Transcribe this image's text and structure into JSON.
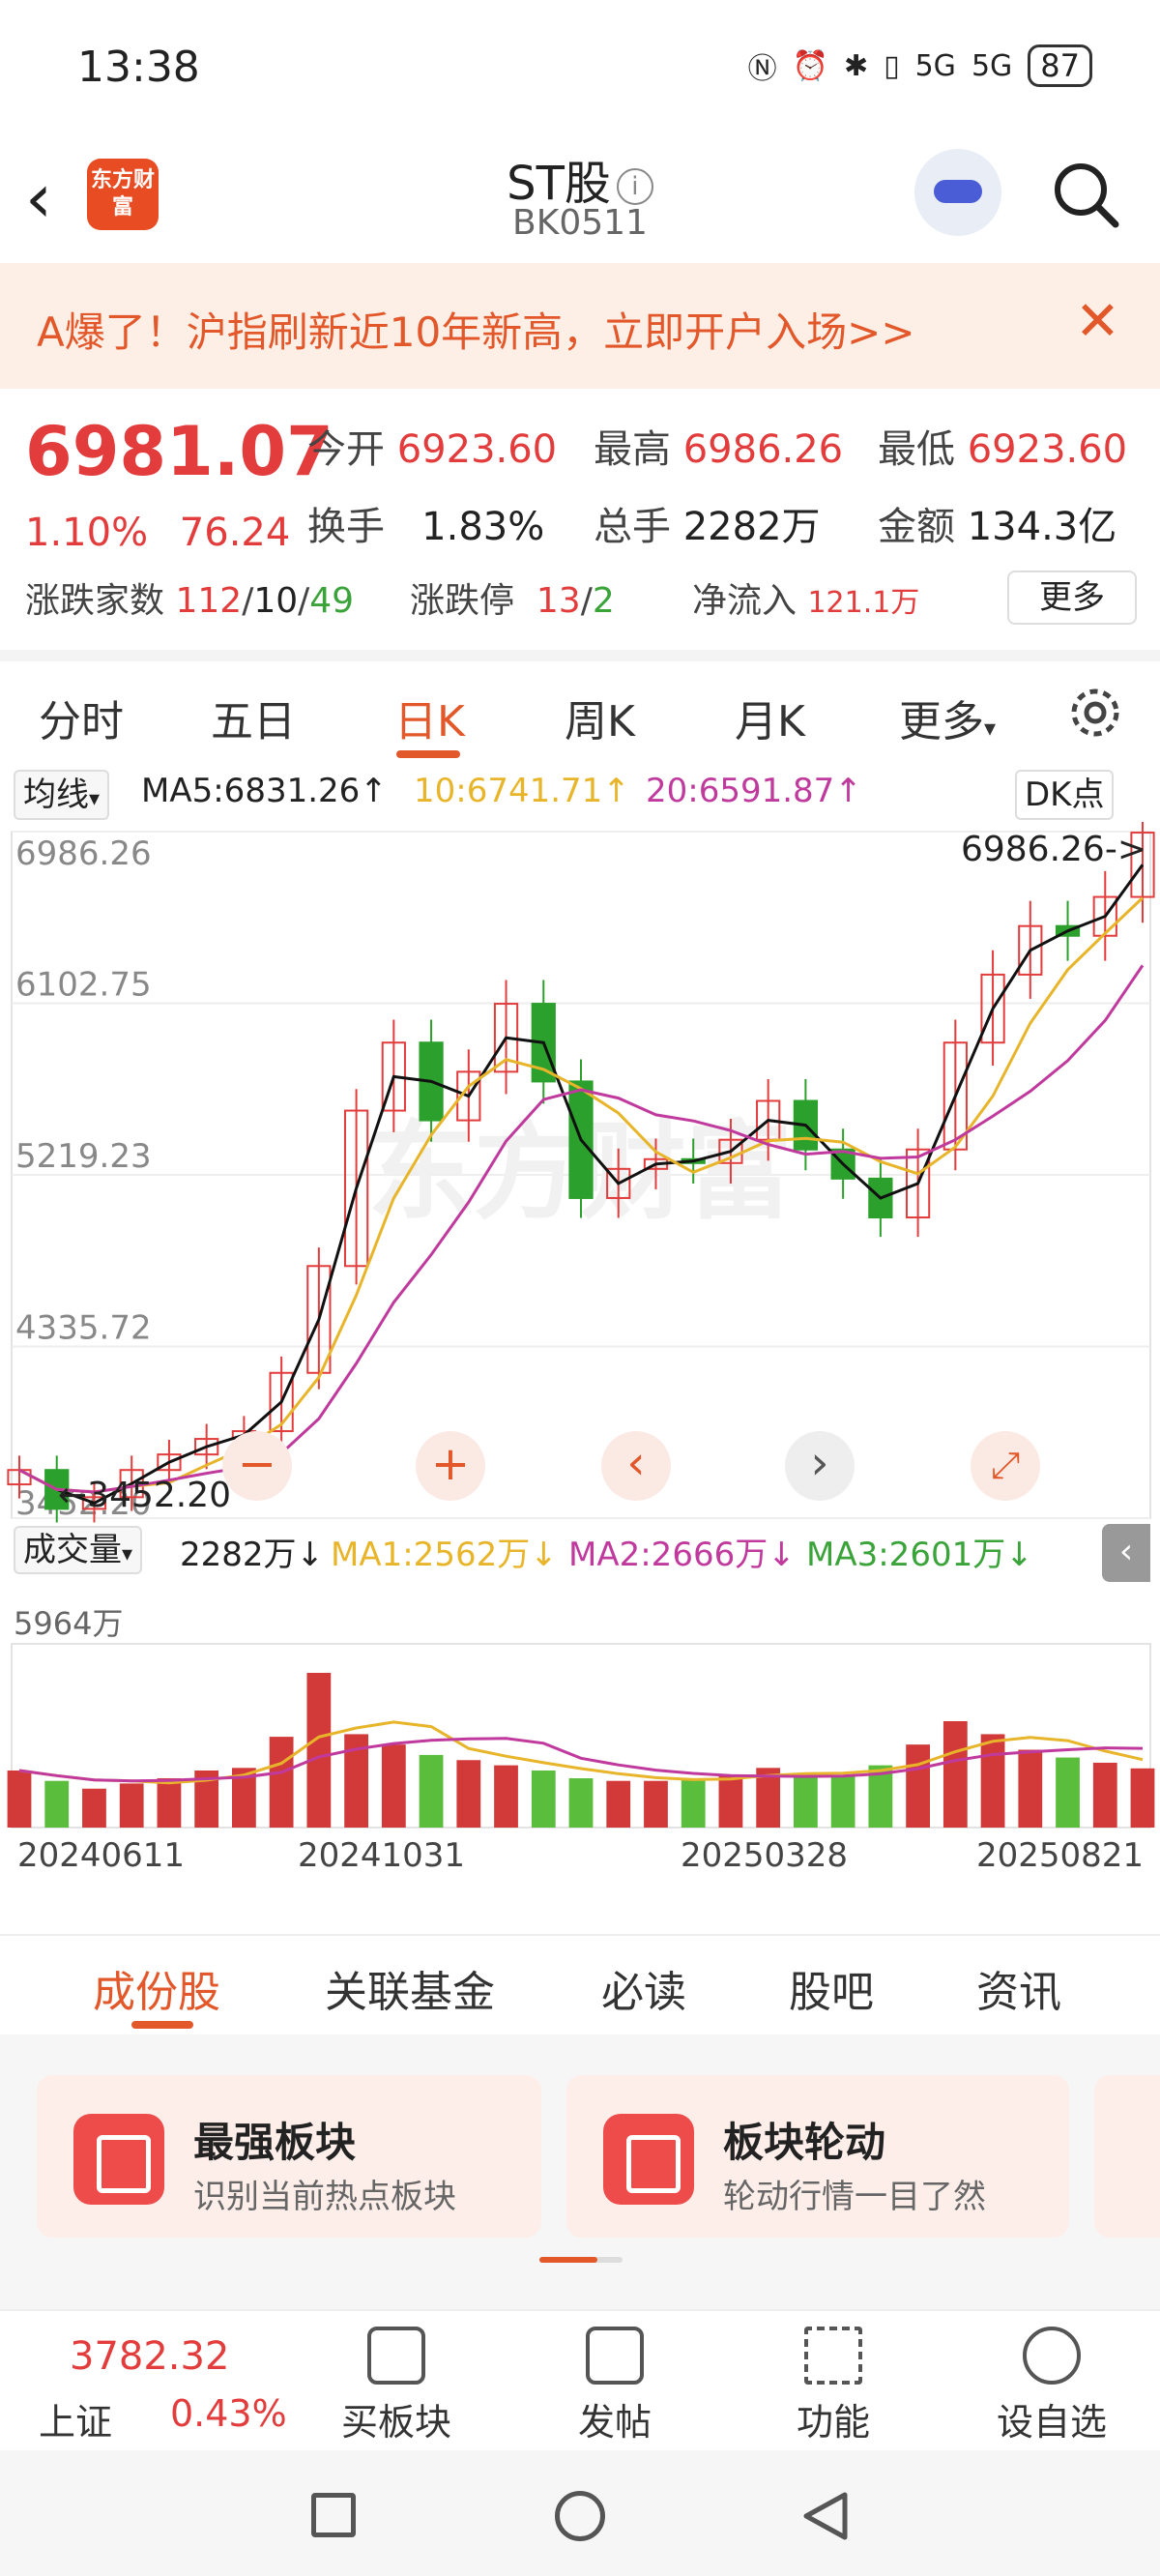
{
  "status": {
    "time": "13:38",
    "network": "5G",
    "battery": "87"
  },
  "header": {
    "title": "ST股",
    "code": "BK0511",
    "logo_text": "东方财富"
  },
  "banner": {
    "text": "A爆了！沪指刷新近10年新高，立即开户入场>>"
  },
  "quote": {
    "price": "6981.07",
    "change_pct": "1.10%",
    "change": "76.24",
    "open_label": "今开",
    "open": "6923.60",
    "high_label": "最高",
    "high": "6986.26",
    "low_label": "最低",
    "low": "6923.60",
    "turnover_label": "换手",
    "turnover": "1.83%",
    "volume_label": "总手",
    "volume": "2282万",
    "amount_label": "金额",
    "amount": "134.3亿",
    "updown_label": "涨跌家数",
    "up": "112",
    "flat": "10",
    "down": "49",
    "limit_label": "涨跌停",
    "limit_up": "13",
    "limit_down": "2",
    "inflow_label": "净流入",
    "inflow": "121.1万",
    "more": "更多"
  },
  "period_tabs": [
    "分时",
    "五日",
    "日K",
    "周K",
    "月K",
    "更多"
  ],
  "ma_bar": {
    "label": "均线",
    "ma5": "MA5:6831.26↑",
    "ma10": "10:6741.71↑",
    "ma20": "20:6591.87↑",
    "dk": "DK点"
  },
  "vol_bar": {
    "label": "成交量",
    "vol": "2282万↓",
    "ma1": "MA1:2562万↓",
    "ma2": "MA2:2666万↓",
    "ma3": "MA3:2601万↓",
    "max": "5964万"
  },
  "chart_data": {
    "type": "candlestick",
    "y_ticks": [
      "6986.26",
      "6102.75",
      "5219.23",
      "4335.72",
      "3452.20"
    ],
    "ylim": [
      3452.2,
      6986.26
    ],
    "x_ticks": [
      "20240611",
      "20241031",
      "20250328",
      "20250821"
    ],
    "annotations": {
      "max": "6986.26->",
      "min": "3452.20"
    },
    "x": [
      0,
      10,
      20,
      30,
      40,
      50,
      60,
      70,
      80,
      90,
      100,
      110,
      120,
      130,
      140,
      150,
      160,
      170,
      180,
      190,
      200,
      210,
      220,
      230,
      240,
      250,
      260,
      270,
      280,
      290,
      300
    ],
    "close": [
      3700,
      3500,
      3560,
      3700,
      3780,
      3860,
      3900,
      4200,
      4750,
      5550,
      5900,
      5500,
      5750,
      6100,
      5700,
      5100,
      5250,
      5300,
      5280,
      5400,
      5600,
      5350,
      5200,
      5000,
      5350,
      5900,
      6250,
      6500,
      6450,
      6650,
      6981
    ],
    "volume": [
      2200,
      1800,
      1500,
      1700,
      1900,
      2200,
      2300,
      3500,
      5964,
      3600,
      3200,
      2800,
      2600,
      2400,
      2200,
      1900,
      1800,
      1800,
      1900,
      2000,
      2300,
      2100,
      2000,
      2400,
      3200,
      4100,
      3600,
      3000,
      2700,
      2500,
      2282
    ],
    "ma_colors": {
      "ma5": "#111111",
      "ma10": "#e8b52a",
      "ma20": "#c03a9e"
    }
  },
  "bottom_tabs": [
    "成份股",
    "关联基金",
    "必读",
    "股吧",
    "资讯"
  ],
  "cards": [
    {
      "title": "最强板块",
      "desc": "识别当前热点板块"
    },
    {
      "title": "板块轮动",
      "desc": "轮动行情一目了然"
    }
  ],
  "index": {
    "value": "3782.32",
    "name": "上证",
    "pct": "0.43%"
  },
  "bottom_bar": [
    "买板块",
    "发帖",
    "功能",
    "设自选"
  ]
}
